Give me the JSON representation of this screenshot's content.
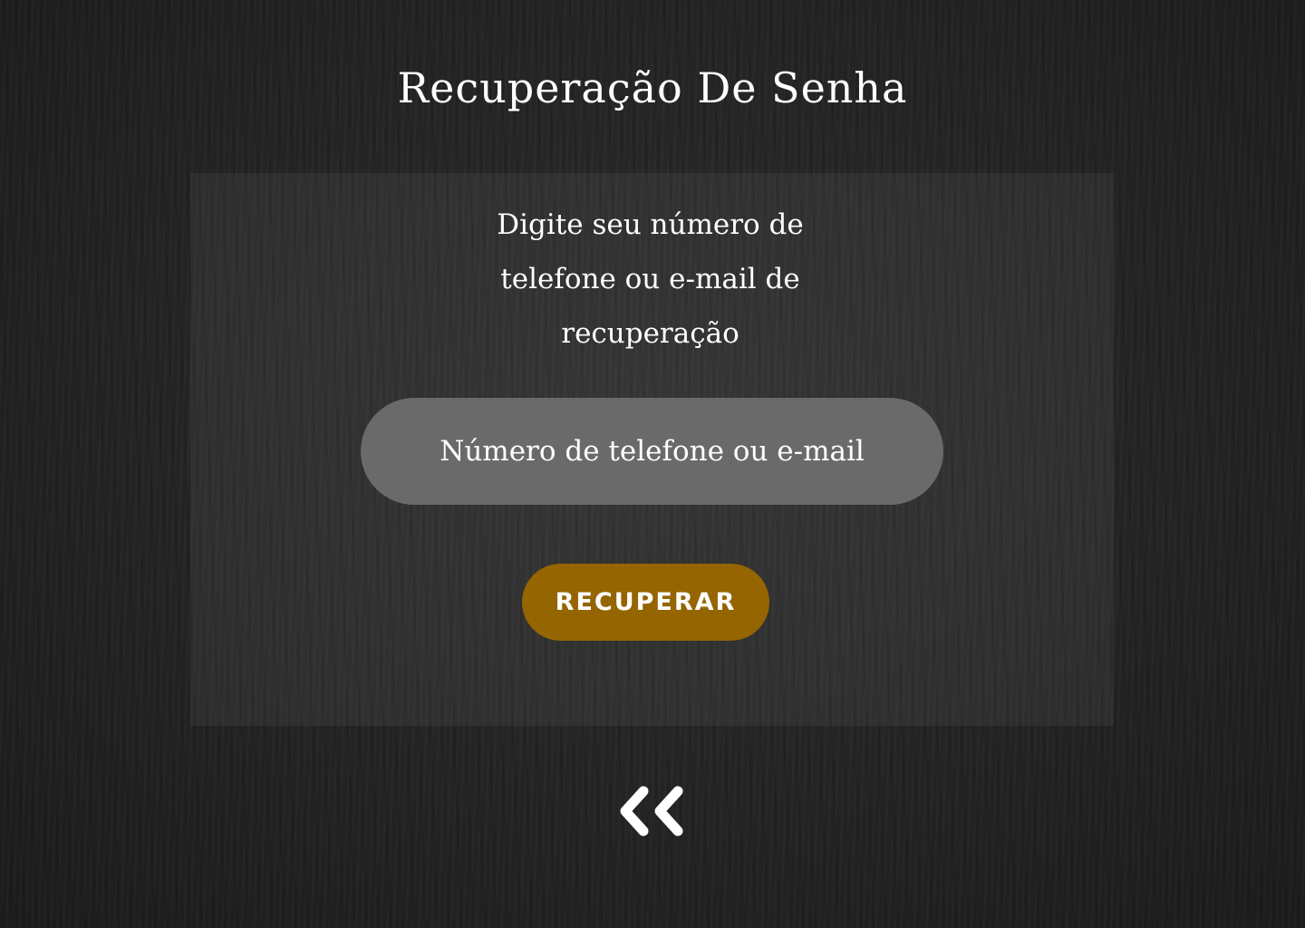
{
  "page": {
    "title": "Recuperação De Senha"
  },
  "form": {
    "instructions": "Digite seu número de telefone ou e-mail de recuperação",
    "contact_input": {
      "value": "",
      "placeholder": "Número de telefone ou e-mail"
    },
    "submit_label": "RECUPERAR"
  },
  "navigation": {
    "back_icon": "double-chevron-left-icon"
  },
  "colors": {
    "background": "#262626",
    "panel_overlay": "rgba(255,255,255,0.05)",
    "input_background": "#6a6a6a",
    "button_accent": "#946500",
    "text": "#ffffff"
  }
}
